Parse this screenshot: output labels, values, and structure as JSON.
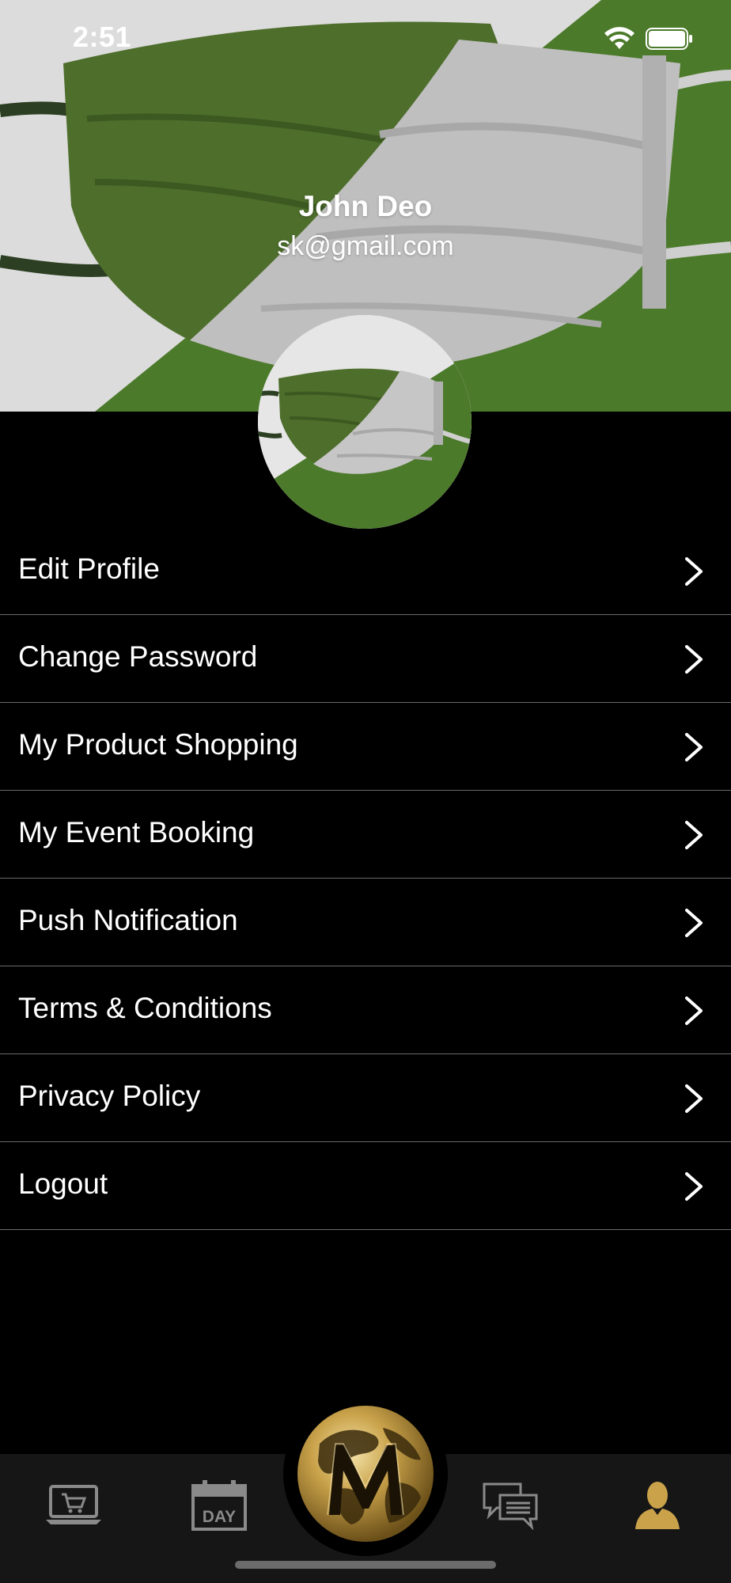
{
  "status_bar": {
    "time": "2:51",
    "wifi_icon": "wifi-icon",
    "battery_icon": "battery-icon"
  },
  "profile": {
    "name": "John Deo",
    "email": "sk@gmail.com",
    "avatar_icon": "face-mask-image"
  },
  "menu": {
    "items": [
      {
        "label": "Edit Profile"
      },
      {
        "label": "Change Password"
      },
      {
        "label": "My Product Shopping"
      },
      {
        "label": "My Event Booking"
      },
      {
        "label": "Push Notification"
      },
      {
        "label": "Terms & Conditions"
      },
      {
        "label": "Privacy Policy"
      },
      {
        "label": "Logout"
      }
    ],
    "chevron_icon": "chevron-right-icon"
  },
  "tab_bar": {
    "tabs": [
      {
        "icon": "laptop-cart-icon"
      },
      {
        "icon": "calendar-day-icon",
        "label": "DAY"
      },
      {
        "icon": "globe-m-logo"
      },
      {
        "icon": "chat-icon"
      },
      {
        "icon": "user-icon",
        "active": true
      }
    ]
  },
  "colors": {
    "accent_gold": "#c9a24a",
    "mask_green": "#4c7a2b",
    "background": "#000000",
    "tab_bar": "#161616"
  }
}
